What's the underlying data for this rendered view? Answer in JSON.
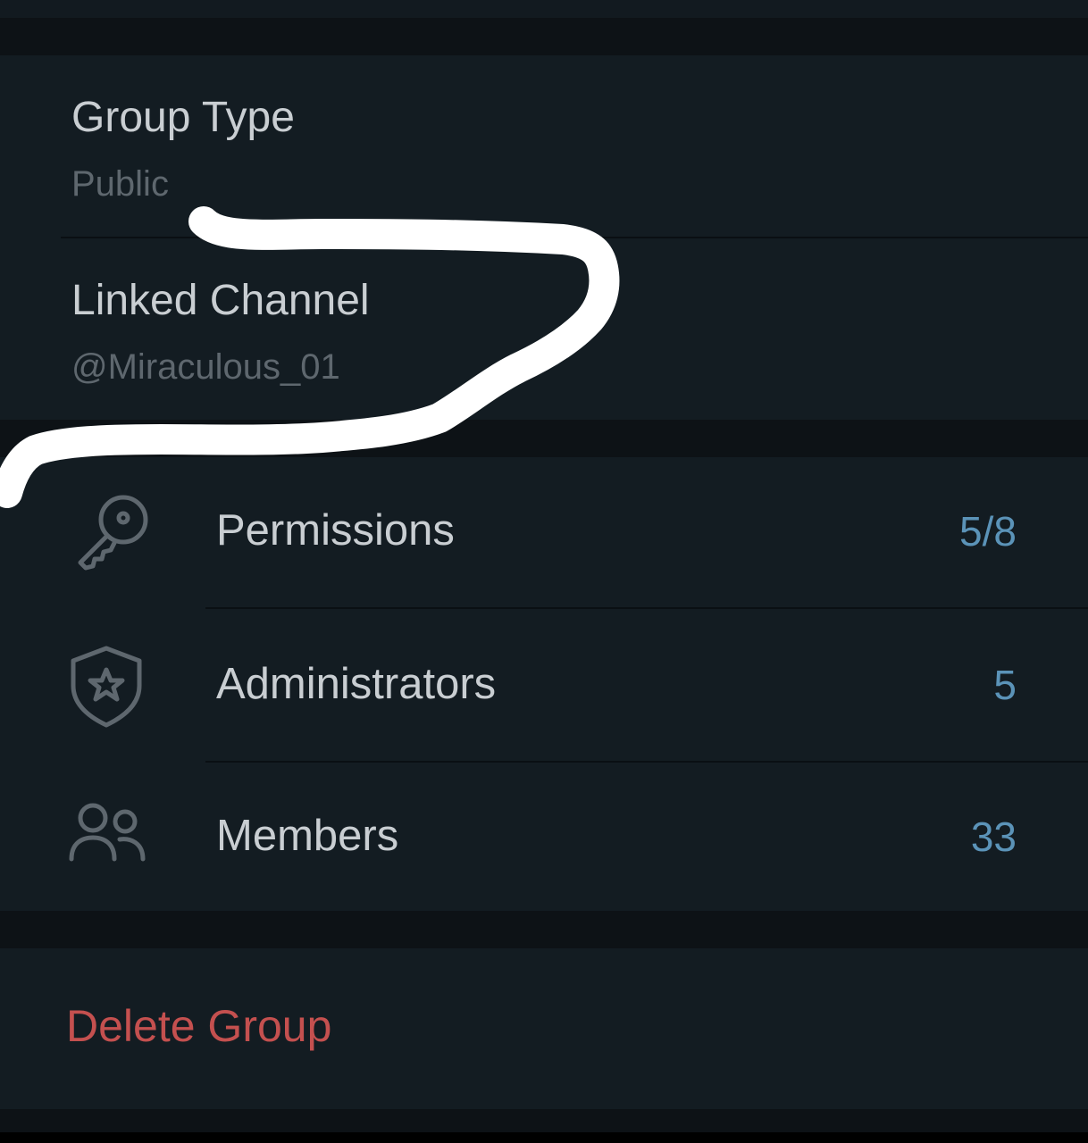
{
  "settings": {
    "group_type": {
      "title": "Group Type",
      "value": "Public"
    },
    "linked_channel": {
      "title": "Linked Channel",
      "value": "@Miraculous_01"
    }
  },
  "management": {
    "permissions": {
      "label": "Permissions",
      "count": "5/8",
      "icon": "key-icon"
    },
    "administrators": {
      "label": "Administrators",
      "count": "5",
      "icon": "shield-star-icon"
    },
    "members": {
      "label": "Members",
      "count": "33",
      "icon": "people-icon"
    }
  },
  "danger_zone": {
    "delete_label": "Delete Group"
  },
  "colors": {
    "background": "#0d1216",
    "card": "#131c22",
    "text_primary": "#c9ced2",
    "text_secondary": "#5e676e",
    "accent_count": "#5b93b8",
    "danger": "#c4504f",
    "annotation_stroke": "#ffffff"
  }
}
